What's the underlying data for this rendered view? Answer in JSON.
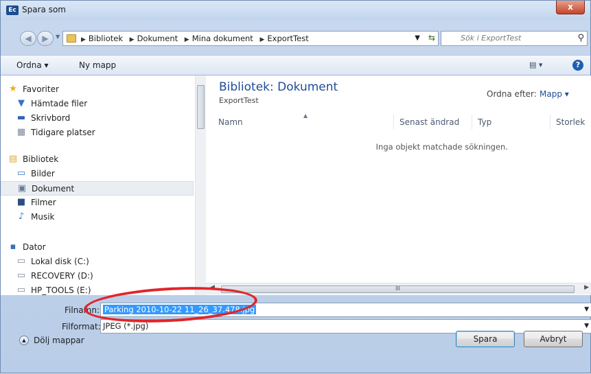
{
  "window": {
    "title": "Spara som",
    "app_icon": "Ec",
    "close_glyph": "x"
  },
  "address": {
    "crumbs": [
      "Bibliotek",
      "Dokument",
      "Mina dokument",
      "ExportTest"
    ],
    "search_placeholder": "Sök i ExportTest"
  },
  "toolbar": {
    "organize": "Ordna ▾",
    "new_folder": "Ny mapp",
    "views": "▤ ▾",
    "help": "?"
  },
  "navigation": {
    "favorites": {
      "label": "Favoriter",
      "items": [
        "Hämtade filer",
        "Skrivbord",
        "Tidigare platser"
      ]
    },
    "libraries": {
      "label": "Bibliotek",
      "items": [
        "Bilder",
        "Dokument",
        "Filmer",
        "Musik"
      ]
    },
    "computer": {
      "label": "Dator",
      "items": [
        "Lokal disk (C:)",
        "RECOVERY (D:)",
        "HP_TOOLS (E:)"
      ]
    },
    "selected": "Dokument"
  },
  "content": {
    "title": "Bibliotek: Dokument",
    "subtitle": "ExportTest",
    "arrange_label": "Ordna efter:",
    "arrange_value": "Mapp ▾",
    "columns": [
      "Namn",
      "Senast ändrad",
      "Typ",
      "Storlek"
    ],
    "empty_message": "Inga objekt matchade sökningen.",
    "scroll_mark": "III"
  },
  "form": {
    "filename_label": "Filnamn:",
    "filename_value": "Parking 2010-10-22 11_26_37.478.jpg",
    "format_label": "Filformat:",
    "format_value": "JPEG (*.jpg)"
  },
  "footer": {
    "toggle_label": "Dölj mappar",
    "save": "Spara",
    "cancel": "Avbryt"
  },
  "colors": {
    "accent": "#1e4c96",
    "selection": "#3399ff",
    "annotation": "#e0262a"
  }
}
